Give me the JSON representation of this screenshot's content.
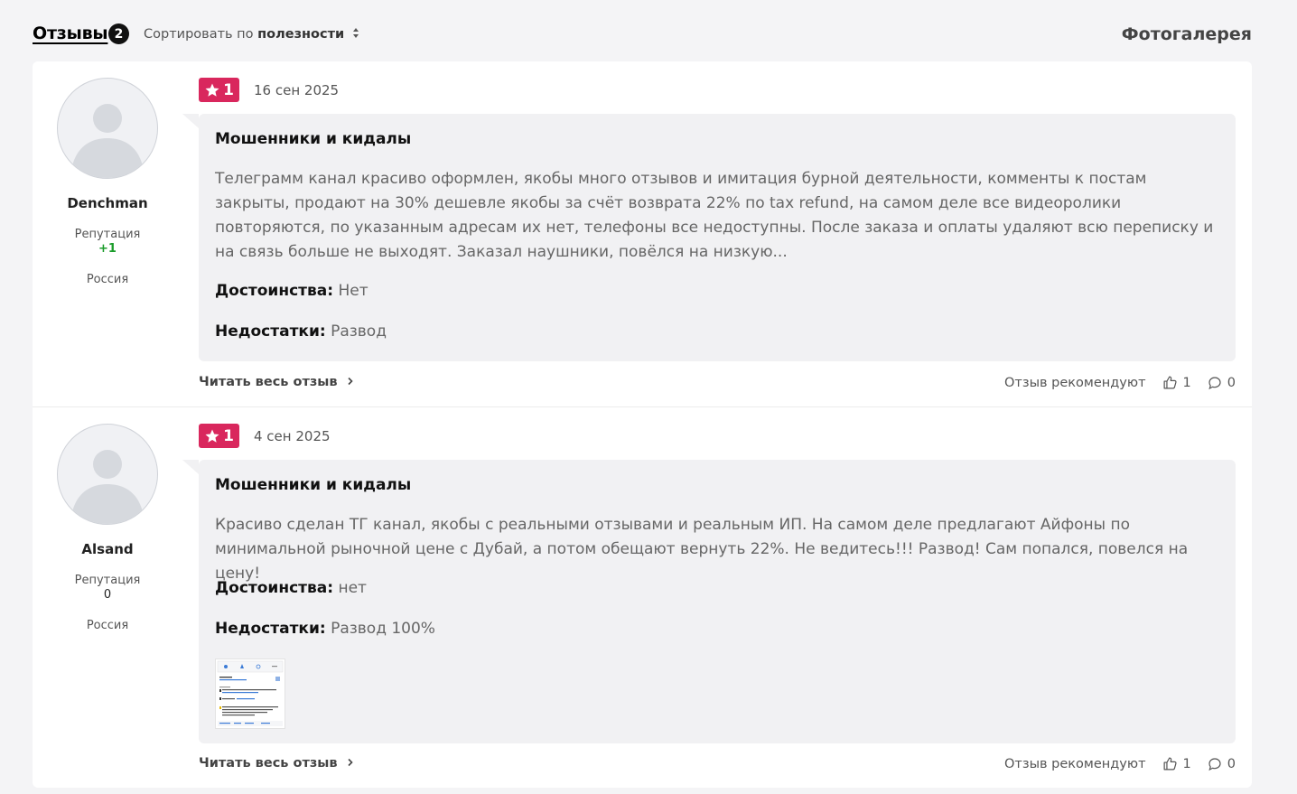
{
  "header": {
    "reviews_tab": "Отзывы",
    "reviews_count": "2",
    "sort_prefix": "Сортировать по",
    "sort_value": "полезности",
    "gallery_link": "Фотогалерея"
  },
  "colors": {
    "rating_badge": "#d9275d",
    "reputation_positive": "#1a9c2a"
  },
  "reviews": [
    {
      "author": "Denchman",
      "reputation_label": "Репутация",
      "reputation_value": "+1",
      "country": "Россия",
      "rating": "1",
      "date": "16 сен 2025",
      "title": "Мошенники и кидалы",
      "text": "Телеграмм канал красиво оформлен, якобы много отзывов и имитация бурной деятельности, комменты к постам закрыты, продают на 30% дешевле якобы за счёт возврата 22% по tax refund, на самом деле все видеоролики повторяются, по указанным адресам их нет, телефоны все недоступны. После заказа и оплаты удаляют всю переписку и на связь больше не выходят. Заказал наушники, повёлся на низкую...",
      "pros_label": "Достоинства:",
      "pros": "Нет",
      "cons_label": "Недостатки:",
      "cons": "Развод",
      "read_more": "Читать весь отзыв",
      "recommend_label": "Отзыв рекомендуют",
      "likes": "1",
      "comments": "0"
    },
    {
      "author": "Alsand",
      "reputation_label": "Репутация",
      "reputation_value": "0",
      "country": "Россия",
      "rating": "1",
      "date": "4 сен 2025",
      "title": "Мошенники и кидалы",
      "text": "Красиво сделан ТГ канал, якобы с реальными отзывами и реальным ИП. На самом деле предлагают Айфоны по минимальной рыночной цене с Дубай, а потом обещают вернуть 22%. Не ведитесь!!! Развод! Сам попался, повелся на цену!",
      "pros_label": "Достоинства:",
      "pros": "нет",
      "cons_label": "Недостатки:",
      "cons": "Развод 100%",
      "read_more": "Читать весь отзыв",
      "recommend_label": "Отзыв рекомендуют",
      "likes": "1",
      "comments": "0"
    }
  ]
}
